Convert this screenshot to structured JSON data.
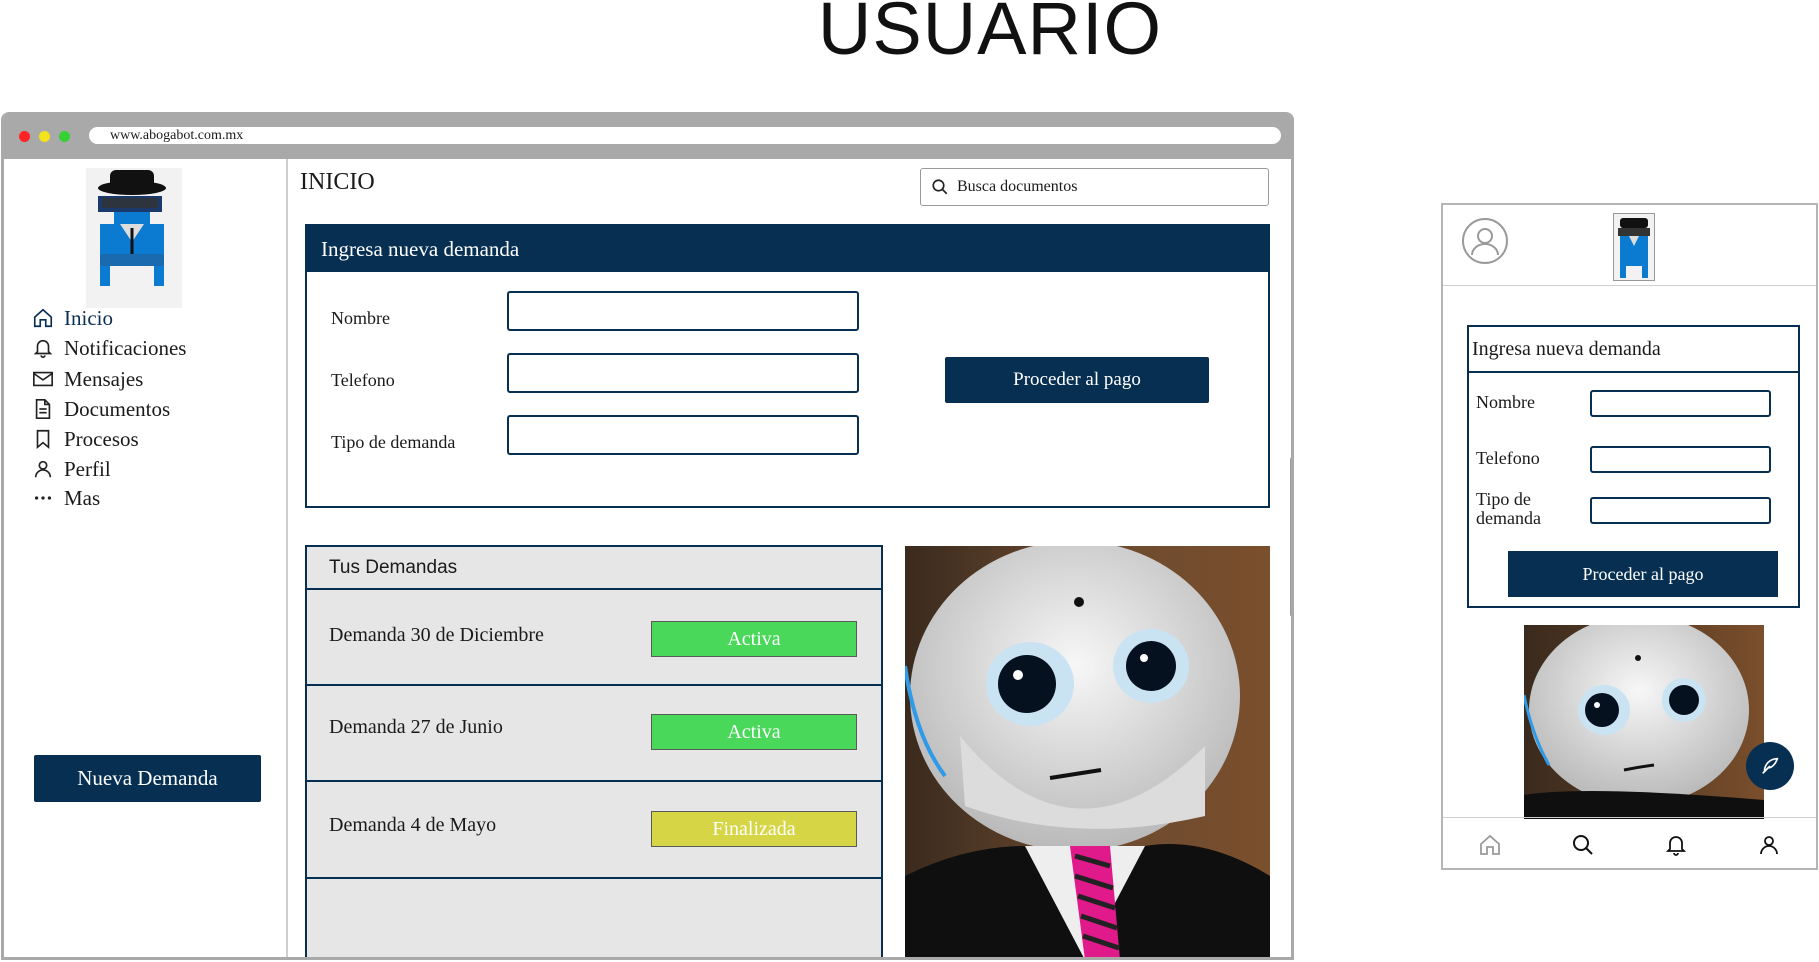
{
  "page_title": "USUARIO",
  "browser": {
    "url": "www.abogabot.com.mx"
  },
  "sidebar": {
    "items": [
      {
        "label": "Inicio",
        "icon": "home-icon"
      },
      {
        "label": "Notificaciones",
        "icon": "bell-icon"
      },
      {
        "label": "Mensajes",
        "icon": "mail-icon"
      },
      {
        "label": "Documentos",
        "icon": "document-icon"
      },
      {
        "label": "Procesos",
        "icon": "bookmark-icon"
      },
      {
        "label": "Perfil",
        "icon": "user-icon"
      },
      {
        "label": "Mas",
        "icon": "more-icon"
      }
    ],
    "new_button": "Nueva Demanda"
  },
  "main": {
    "title": "INICIO",
    "search_placeholder": "Busca documentos",
    "form": {
      "title": "Ingresa nueva demanda",
      "fields": {
        "name": "Nombre",
        "phone": "Telefono",
        "type": "Tipo de demanda"
      },
      "pay_button": "Proceder al pago"
    },
    "demands": {
      "title": "Tus Demandas",
      "rows": [
        {
          "name": "Demanda 30 de Diciembre",
          "status": "Activa"
        },
        {
          "name": "Demanda 27 de Junio",
          "status": "Activa"
        },
        {
          "name": "Demanda 4 de Mayo",
          "status": "Finalizada"
        }
      ]
    }
  },
  "mobile": {
    "form_title": "Ingresa nueva demanda",
    "name_label": "Nombre",
    "phone_label": "Telefono",
    "type_label_1": "Tipo de",
    "type_label_2": "demanda",
    "pay_button": "Proceder al pago"
  },
  "colors": {
    "primary": "#062f52",
    "active": "#49d85a",
    "finished": "#d5d545",
    "frame": "#a9a9a9"
  }
}
